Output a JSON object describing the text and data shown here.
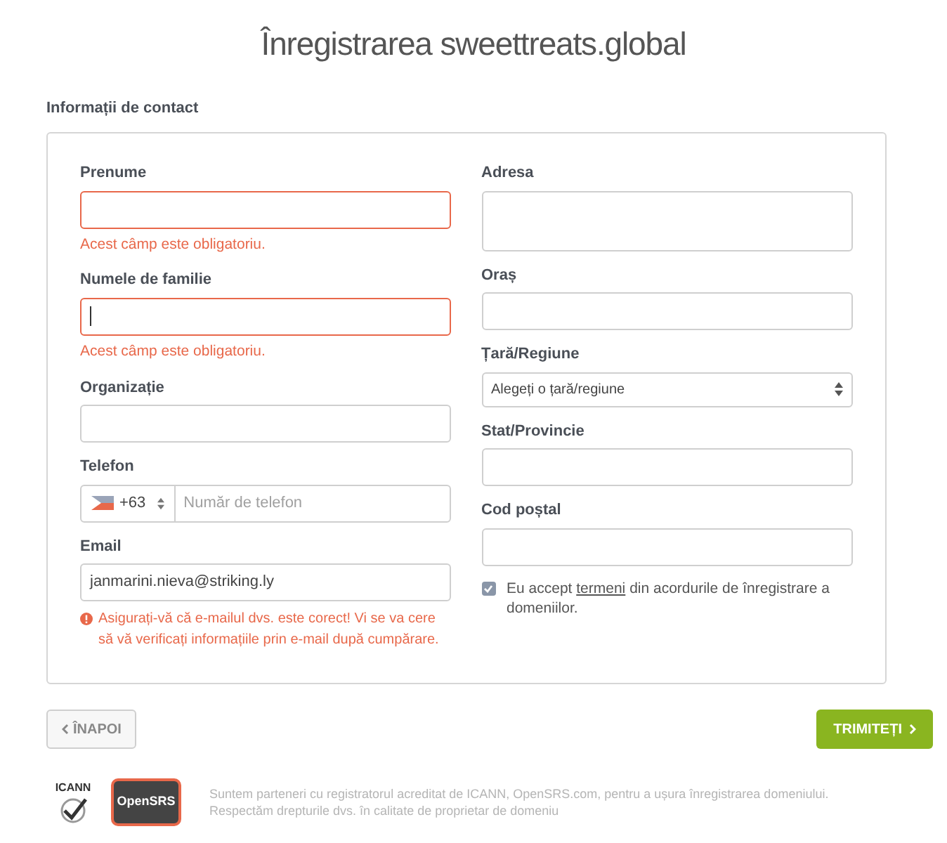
{
  "title": "Înregistrarea sweettreats.global",
  "section_title": "Informații de contact",
  "left_fields": [
    {
      "kind": "text",
      "label": "Prenume",
      "invalid": true,
      "error": "Acest câmp este obligatoriu."
    },
    {
      "kind": "text",
      "label": "Numele de familie",
      "invalid": true,
      "focused": true,
      "error": "Acest câmp este obligatoriu."
    },
    {
      "kind": "text",
      "label": "Organizație",
      "invalid": false
    },
    {
      "kind": "phone",
      "label": "Telefon",
      "code": "+63",
      "placeholder": "Număr de telefon"
    },
    {
      "kind": "text",
      "label": "Email",
      "invalid": false,
      "value": "janmarini.nieva@striking.ly",
      "warning": "Asigurați-vă că e-mailul dvs. este corect! Vi se va cere să vă verificați informațiile prin e-mail după cumpărare."
    }
  ],
  "right_fields": [
    {
      "kind": "textarea",
      "label": "Adresa"
    },
    {
      "kind": "text",
      "label": "Oraș"
    },
    {
      "kind": "select",
      "label": "Țară/Regiune",
      "value": "Alegeți o țară/regiune"
    },
    {
      "kind": "text",
      "label": "Stat/Provincie"
    },
    {
      "kind": "text",
      "label": "Cod poștal"
    }
  ],
  "terms": {
    "checked": true,
    "before": "Eu accept",
    "link": "termeni",
    "after": "din acordurile de înregistrare a domeniilor."
  },
  "back_button": "ÎNAPOI",
  "submit_button": "TRIMITEȚI",
  "footer_logos": [
    "ICANN",
    "OpenSRS"
  ],
  "footer_text": "Suntem parteneri cu registratorul acreditat de ICANN, OpenSRS.com, pentru a ușura înregistrarea domeniului. Respectăm drepturile dvs. în calitate de proprietar de domeniu"
}
